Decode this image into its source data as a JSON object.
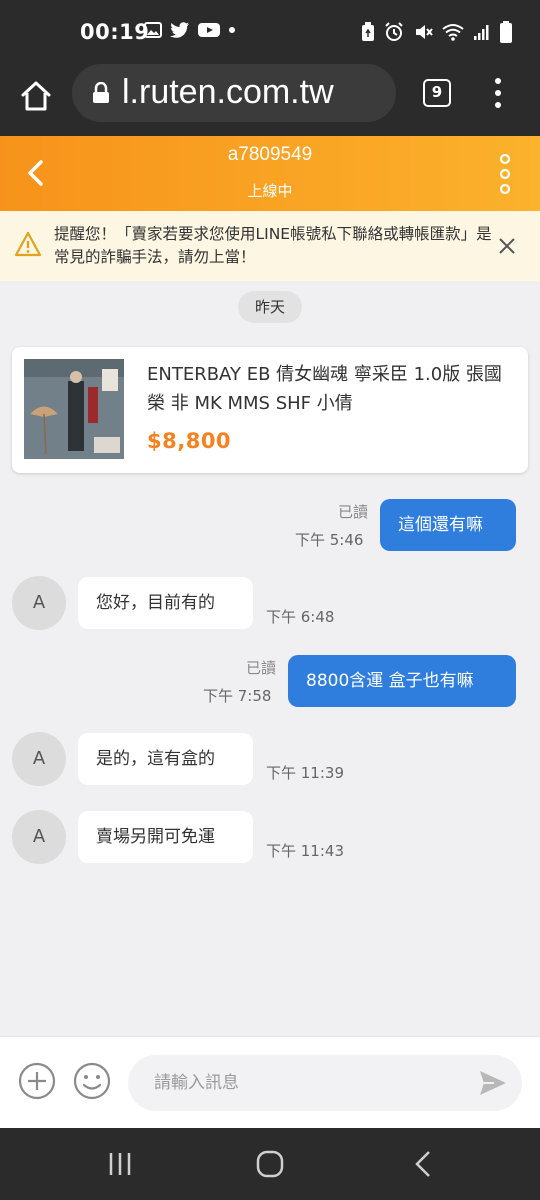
{
  "status_bar": {
    "time": "00:19"
  },
  "browser": {
    "url": "l.ruten.com.tw",
    "tab_count": "9"
  },
  "header": {
    "name": "a7809549",
    "status": "上線中"
  },
  "warning": {
    "text": "提醒您！「賣家若要求您使用LINE帳號私下聯絡或轉帳匯款」是常見的詐騙手法，請勿上當！"
  },
  "date_divider": "昨天",
  "product": {
    "title": "ENTERBAY EB 倩女幽魂 寧采臣 1.0版 張國榮 非 MK MMS SHF 小倩",
    "price": "$8,800"
  },
  "messages": [
    {
      "direction": "out",
      "text": "這個還有嘛",
      "read": "已讀",
      "time": "下午 5:46"
    },
    {
      "direction": "in",
      "avatar": "A",
      "text": "您好，目前有的",
      "time": "下午 6:48"
    },
    {
      "direction": "out",
      "text": "8800含運 盒子也有嘛",
      "read": "已讀",
      "time": "下午 7:58"
    },
    {
      "direction": "in",
      "avatar": "A",
      "text": "是的，這有盒的",
      "time": "下午 11:39"
    },
    {
      "direction": "in",
      "avatar": "A",
      "text": "賣場另開可免運",
      "time": "下午 11:43"
    }
  ],
  "input": {
    "placeholder": "請輸入訊息"
  },
  "colors": {
    "accent_orange": "#f7931a",
    "price_orange": "#f58220",
    "bubble_blue": "#2f7ddc",
    "warning_bg": "#fdf6e3"
  },
  "icons": [
    "home-icon",
    "lock-icon",
    "tabs-icon",
    "overflow-menu-icon",
    "back-chevron-icon",
    "more-vertical-icon",
    "warning-icon",
    "close-icon",
    "add-icon",
    "emoji-icon",
    "send-icon",
    "recents-icon",
    "nav-home-icon",
    "nav-back-icon"
  ]
}
